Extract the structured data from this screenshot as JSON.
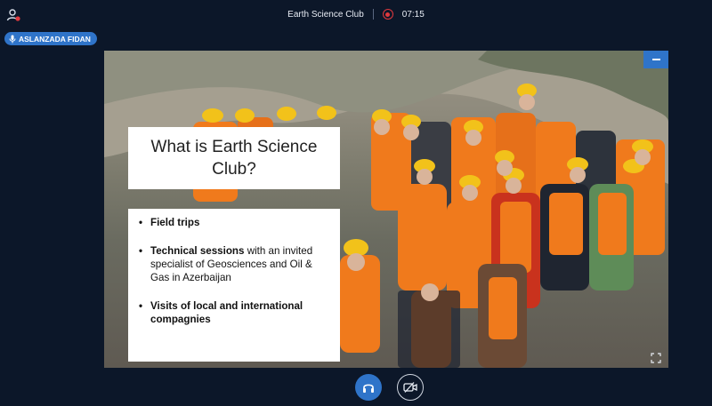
{
  "header": {
    "title": "Earth Science Club",
    "timer": "07:15",
    "user_icon": "user-notification-icon",
    "record_icon": "record-icon"
  },
  "speaker": {
    "name": "ASLANZADA FIDAN",
    "icon": "microphone-icon"
  },
  "slide": {
    "title": "What is Earth Science Club?",
    "bullets": [
      {
        "bold": "Field trips",
        "text": ""
      },
      {
        "bold": "Technical sessions",
        "text": " with an invited specialist of Geosciences and Oil & Gas in Azerbaijan"
      },
      {
        "bold": "Visits of local and international compagnies",
        "text": ""
      }
    ]
  },
  "controls": {
    "audio_icon": "headset-icon",
    "video_icon": "camera-off-icon"
  },
  "colors": {
    "background": "#0c1729",
    "accent": "#2f74c9",
    "record": "#e0393e",
    "vest": "#f07a1c",
    "helmet": "#f2c21a"
  }
}
